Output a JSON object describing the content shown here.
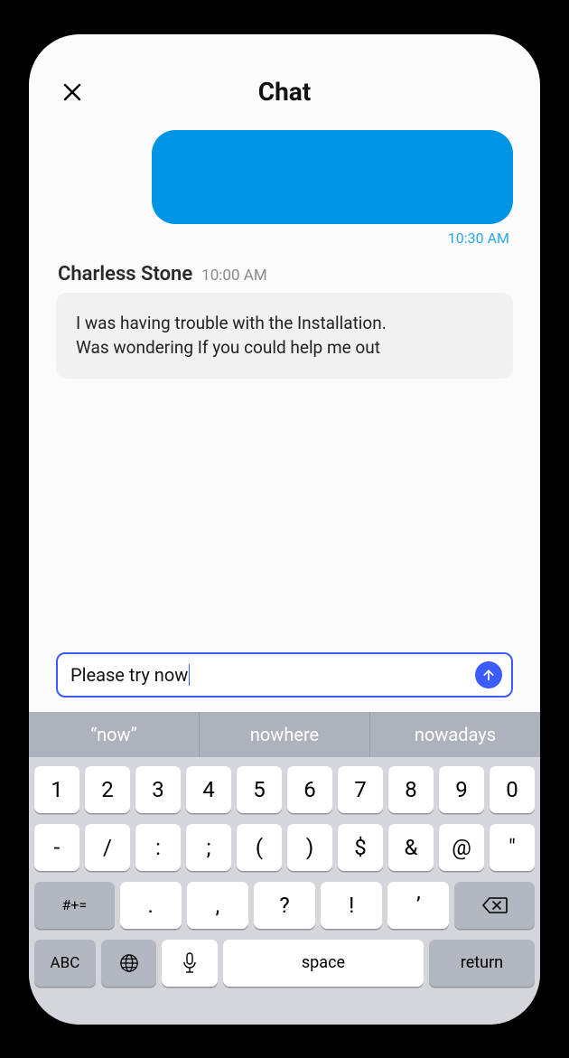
{
  "header": {
    "title": "Chat"
  },
  "messages": {
    "outgoing": {
      "time": "10:30 AM"
    },
    "incoming": {
      "name": "Charless Stone",
      "time": "10:00 AM",
      "line1": "I was having trouble with the Installation.",
      "line2": "Was wondering If you could help me out"
    }
  },
  "composer": {
    "text": "Please try now"
  },
  "keyboard": {
    "suggestions": [
      "“now”",
      "nowhere",
      "nowadays"
    ],
    "row1": [
      "1",
      "2",
      "3",
      "4",
      "5",
      "6",
      "7",
      "8",
      "9",
      "0"
    ],
    "row2": [
      "-",
      "/",
      ":",
      ";",
      "(",
      ")",
      "$",
      "&",
      "@",
      "″"
    ],
    "row3_shift": "#+=",
    "row3": [
      ".",
      ",",
      "?",
      "!",
      "’"
    ],
    "row4_abc": "ABC",
    "row4_space": "space",
    "row4_return": "return"
  }
}
